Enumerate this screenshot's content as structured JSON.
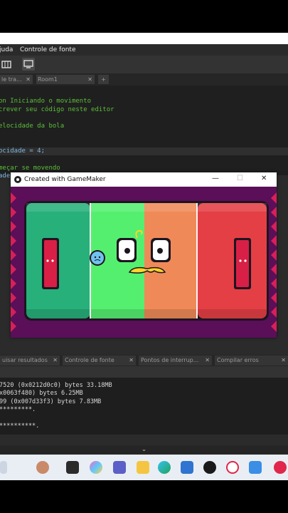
{
  "menu": {
    "items": [
      "juda",
      "Controle de fonte"
    ]
  },
  "editor_tabs": [
    {
      "label": "le tra..."
    },
    {
      "label": "Room1"
    }
  ],
  "add_tab_label": "+",
  "code_lines": [
    "on Iniciando o movimento",
    "crever seu código neste editor",
    "elocidade da bola",
    "ocidade = 4;",
    "meçar se movendo",
    "ade"
  ],
  "game_window": {
    "title": "Created with GameMaker",
    "minimize": "—",
    "maximize": "☐",
    "close": "✕"
  },
  "bottom_tabs": [
    {
      "label": "uisar resultados"
    },
    {
      "label": "Controle de fonte"
    },
    {
      "label": "Pontos de interrup..."
    },
    {
      "label": "Compilar erros"
    }
  ],
  "output_lines": [
    "7520 (0x0212d0c0) bytes 33.18MB",
    "x0063f480) bytes 6.25MB",
    "99 (0x007d33f3) bytes 7.83MB",
    "*********.",
    "",
    "**********."
  ],
  "panel_toggle": "⌄",
  "colors": {
    "court_left": "#27b07a",
    "court_mid": "#55ef70",
    "court_orange": "#ef8a58",
    "court_right": "#e43f45",
    "window_bg": "#5a0f58",
    "paddle": "#d81f45",
    "mustache": "#ffd32a"
  },
  "taskbar_icons": [
    "avatar-icon",
    "terminal-icon",
    "copilot-icon",
    "teams-icon",
    "files-icon",
    "edge-icon",
    "store-icon",
    "dell-icon",
    "opera-icon",
    "chat-icon",
    "gamemaker-icon"
  ]
}
